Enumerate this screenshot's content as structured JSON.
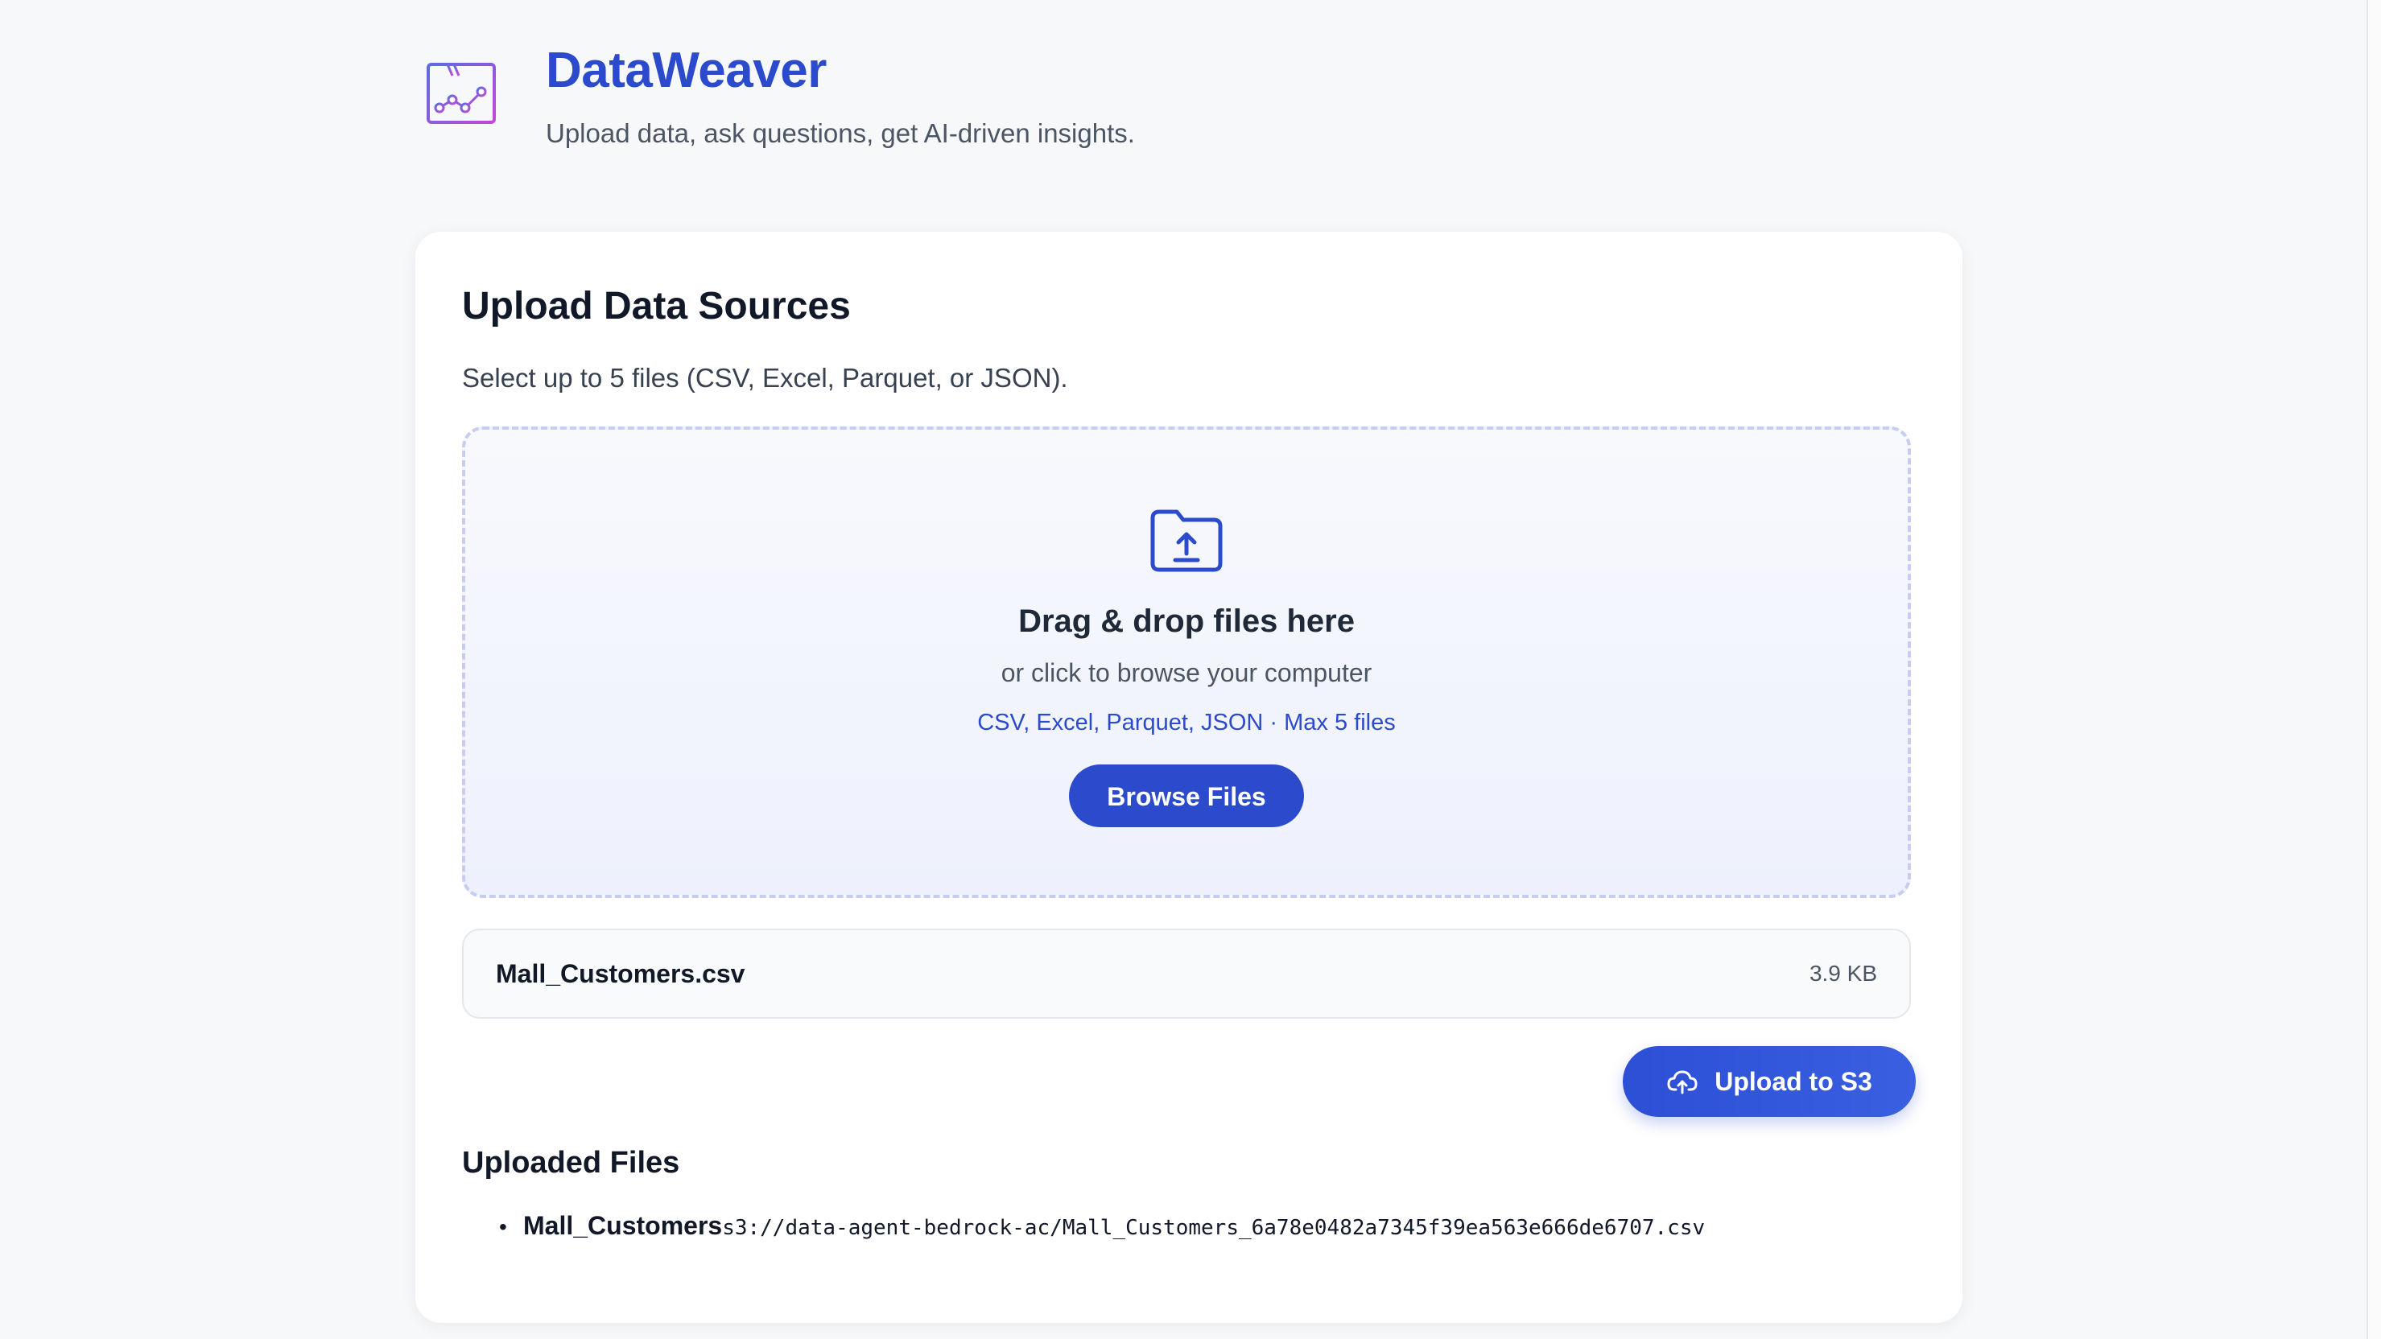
{
  "app": {
    "title": "DataWeaver",
    "subtitle": "Upload data, ask questions, get AI-driven insights.",
    "logo_icon": "chart-window-icon"
  },
  "upload_card": {
    "title": "Upload Data Sources",
    "description": "Select up to 5 files (CSV, Excel, Parquet, or JSON).",
    "dropzone": {
      "icon": "folder-upload-icon",
      "title": "Drag & drop files here",
      "subtitle": "or click to browse your computer",
      "hint": "CSV, Excel, Parquet, JSON · Max 5 files",
      "browse_label": "Browse Files"
    },
    "selected_files": [
      {
        "name": "Mall_Customers.csv",
        "size": "3.9 KB"
      }
    ],
    "upload_button": {
      "label": "Upload to S3",
      "icon": "cloud-upload-icon"
    }
  },
  "uploaded": {
    "title": "Uploaded Files",
    "files": [
      {
        "name": "Mall_Customers",
        "path": "s3://data-agent-bedrock-ac/Mall_Customers_6a78e0482a7345f39ea563e666de6707.csv"
      }
    ]
  },
  "colors": {
    "accent": "#2b4bcc",
    "background": "#f7f8fa",
    "card": "#ffffff",
    "logo_gradient_start": "#6d5bd9",
    "logo_gradient_end": "#c04ad8"
  }
}
